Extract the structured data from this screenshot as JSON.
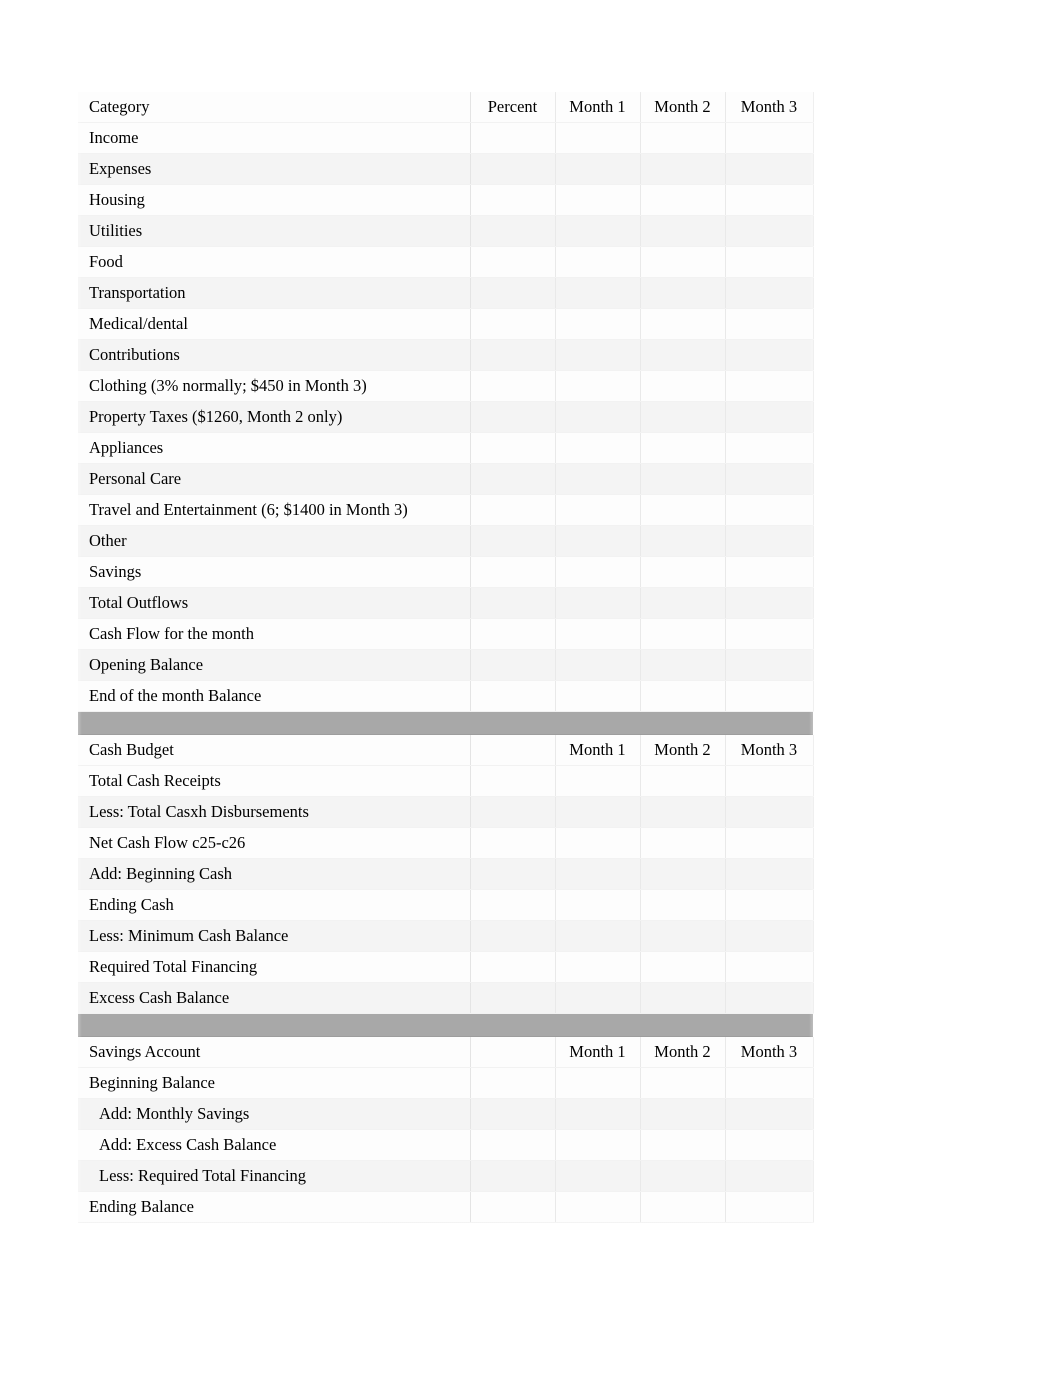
{
  "document": {
    "title": "Personal Budget and Cash Budget Worksheet",
    "page_background": "#ffffff",
    "sheet_background": "#fbfbfb",
    "separator_color": "#a8a8a8",
    "grid_line_color": "#e9e9e9",
    "alt_row_color": "#f4f4f4"
  },
  "sections": [
    {
      "id": "personal-budget",
      "header": {
        "label": "Category",
        "percent": "Percent",
        "month1": "Month 1",
        "month2": "Month 2",
        "month3": "Month 3"
      },
      "rows": [
        {
          "label": "Income",
          "indent": false,
          "percent": "",
          "month1": "",
          "month2": "",
          "month3": ""
        },
        {
          "label": "Expenses",
          "indent": false,
          "percent": "",
          "month1": "",
          "month2": "",
          "month3": ""
        },
        {
          "label": "Housing",
          "indent": false,
          "percent": "",
          "month1": "",
          "month2": "",
          "month3": ""
        },
        {
          "label": "Utilities",
          "indent": false,
          "percent": "",
          "month1": "",
          "month2": "",
          "month3": ""
        },
        {
          "label": "Food",
          "indent": false,
          "percent": "",
          "month1": "",
          "month2": "",
          "month3": ""
        },
        {
          "label": "Transportation",
          "indent": false,
          "percent": "",
          "month1": "",
          "month2": "",
          "month3": ""
        },
        {
          "label": "Medical/dental",
          "indent": false,
          "percent": "",
          "month1": "",
          "month2": "",
          "month3": ""
        },
        {
          "label": "Contributions",
          "indent": false,
          "percent": "",
          "month1": "",
          "month2": "",
          "month3": ""
        },
        {
          "label": "Clothing (3% normally; $450 in Month 3)",
          "indent": false,
          "percent": "",
          "month1": "",
          "month2": "",
          "month3": ""
        },
        {
          "label": "Property Taxes ($1260, Month 2 only)",
          "indent": false,
          "percent": "",
          "month1": "",
          "month2": "",
          "month3": ""
        },
        {
          "label": "Appliances",
          "indent": false,
          "percent": "",
          "month1": "",
          "month2": "",
          "month3": ""
        },
        {
          "label": "Personal Care",
          "indent": false,
          "percent": "",
          "month1": "",
          "month2": "",
          "month3": ""
        },
        {
          "label": "Travel and Entertainment (6; $1400 in Month 3)",
          "indent": false,
          "percent": "",
          "month1": "",
          "month2": "",
          "month3": ""
        },
        {
          "label": "Other",
          "indent": false,
          "percent": "",
          "month1": "",
          "month2": "",
          "month3": ""
        },
        {
          "label": "Savings",
          "indent": false,
          "percent": "",
          "month1": "",
          "month2": "",
          "month3": ""
        },
        {
          "label": "Total Outflows",
          "indent": false,
          "percent": "",
          "month1": "",
          "month2": "",
          "month3": ""
        },
        {
          "label": "Cash Flow for the month",
          "indent": false,
          "percent": "",
          "month1": "",
          "month2": "",
          "month3": ""
        },
        {
          "label": "Opening Balance",
          "indent": false,
          "percent": "",
          "month1": "",
          "month2": "",
          "month3": ""
        },
        {
          "label": "End of the month Balance",
          "indent": false,
          "percent": "",
          "month1": "",
          "month2": "",
          "month3": ""
        }
      ]
    },
    {
      "id": "cash-budget",
      "header": {
        "label": "Cash Budget",
        "percent": "",
        "month1": "Month 1",
        "month2": "Month 2",
        "month3": "Month 3"
      },
      "rows": [
        {
          "label": "Total Cash Receipts",
          "indent": false,
          "percent": "",
          "month1": "",
          "month2": "",
          "month3": ""
        },
        {
          "label": "Less: Total Casxh Disbursements",
          "indent": false,
          "percent": "",
          "month1": "",
          "month2": "",
          "month3": ""
        },
        {
          "label": "Net Cash Flow c25-c26",
          "indent": false,
          "percent": "",
          "month1": "",
          "month2": "",
          "month3": ""
        },
        {
          "label": "Add: Beginning Cash",
          "indent": false,
          "percent": "",
          "month1": "",
          "month2": "",
          "month3": ""
        },
        {
          "label": "Ending Cash",
          "indent": false,
          "percent": "",
          "month1": "",
          "month2": "",
          "month3": ""
        },
        {
          "label": "Less: Minimum Cash Balance",
          "indent": false,
          "percent": "",
          "month1": "",
          "month2": "",
          "month3": ""
        },
        {
          "label": "Required Total Financing",
          "indent": false,
          "percent": "",
          "month1": "",
          "month2": "",
          "month3": ""
        },
        {
          "label": "Excess Cash Balance",
          "indent": false,
          "percent": "",
          "month1": "",
          "month2": "",
          "month3": ""
        }
      ]
    },
    {
      "id": "savings-account",
      "header": {
        "label": "Savings Account",
        "percent": "",
        "month1": "Month 1",
        "month2": "Month 2",
        "month3": "Month 3"
      },
      "rows": [
        {
          "label": "Beginning Balance",
          "indent": false,
          "percent": "",
          "month1": "",
          "month2": "",
          "month3": ""
        },
        {
          "label": "Add: Monthly Savings",
          "indent": true,
          "percent": "",
          "month1": "",
          "month2": "",
          "month3": ""
        },
        {
          "label": "Add: Excess Cash Balance",
          "indent": true,
          "percent": "",
          "month1": "",
          "month2": "",
          "month3": ""
        },
        {
          "label": "Less: Required Total Financing",
          "indent": true,
          "percent": "",
          "month1": "",
          "month2": "",
          "month3": ""
        },
        {
          "label": "Ending Balance",
          "indent": false,
          "percent": "",
          "month1": "",
          "month2": "",
          "month3": ""
        }
      ]
    }
  ]
}
